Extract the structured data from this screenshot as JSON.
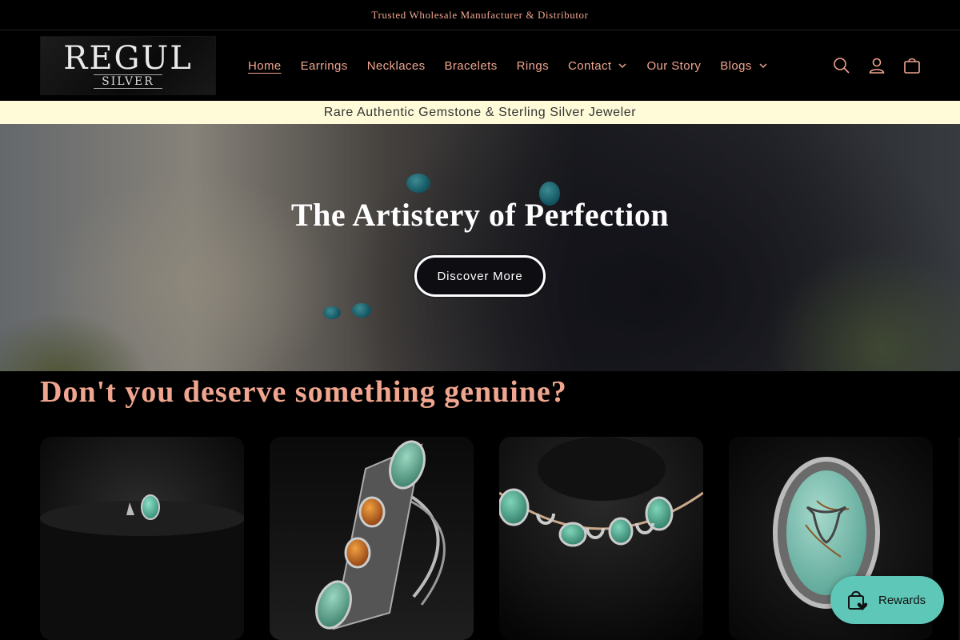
{
  "announcement": {
    "text": "Trusted Wholesale Manufacturer & Distributor"
  },
  "header": {
    "logo": {
      "line1": "REGUL",
      "line2": "SILVER"
    },
    "nav": [
      {
        "label": "Home",
        "active": true,
        "dropdown": false
      },
      {
        "label": "Earrings",
        "active": false,
        "dropdown": false
      },
      {
        "label": "Necklaces",
        "active": false,
        "dropdown": false
      },
      {
        "label": "Bracelets",
        "active": false,
        "dropdown": false
      },
      {
        "label": "Rings",
        "active": false,
        "dropdown": false
      },
      {
        "label": "Contact",
        "active": false,
        "dropdown": true
      },
      {
        "label": "Our Story",
        "active": false,
        "dropdown": false
      },
      {
        "label": "Blogs",
        "active": false,
        "dropdown": true
      }
    ],
    "icons": [
      "search-icon",
      "account-icon",
      "cart-icon"
    ]
  },
  "promo_bar": {
    "text": "Rare Authentic Gemstone & Sterling Silver Jeweler"
  },
  "hero": {
    "title": "The Artistery of Perfection",
    "button_label": "Discover More"
  },
  "collection": {
    "heading": "Don't you deserve something genuine?",
    "products": [
      {
        "image": "turquoise-ring-on-black-stand"
      },
      {
        "image": "turquoise-spiny-oyster-long-ring"
      },
      {
        "image": "turquoise-horseshoe-necklace"
      },
      {
        "image": "turquoise-steer-skull-ring"
      }
    ]
  },
  "rewards_widget": {
    "label": "Rewards",
    "icon": "shopping-bag-heart-icon"
  },
  "colors": {
    "accent": "#f0a58f",
    "background": "#000000",
    "promo_background": "#fffbd9",
    "rewards_background": "#5fc7b8"
  }
}
